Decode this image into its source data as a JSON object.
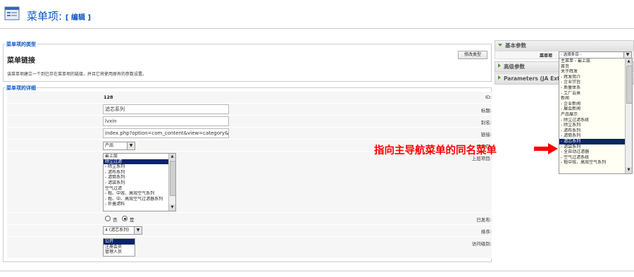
{
  "header": {
    "title": "菜单项:",
    "subtitle": "[ 编辑 ]"
  },
  "type_section": {
    "legend": "菜单项的类型",
    "heading": "菜单链接",
    "change_button": "修改类型",
    "description": "该菜单项建立一个到已存在菜单项的链接，并且它将使用原有的参数设置。"
  },
  "details": {
    "legend": "菜单项的详细",
    "id_label": "ID:",
    "id_value": "128",
    "title_label": "标题:",
    "title_value": "滤芯系列",
    "alias_label": "别名:",
    "alias_value": "lvxin",
    "link_label": "链接:",
    "link_value": "index.php?option=com_content&view=category&la",
    "menu_label": "显示在:",
    "menu_value": "产品",
    "parent_label": "上层项目:",
    "parent_items": [
      "最上层",
      "除尘过滤",
      "- 除尘系列",
      "- 滤布系列",
      "- 滤筒系列",
      "- 滤袋系列",
      "空气过滤",
      "- 粗、中效、高效空气系列",
      "- 粗、中、高效空气过滤器系列",
      "- 折叠滤料"
    ],
    "parent_selected_index": 1,
    "published_label": "已发布:",
    "published_no": "否",
    "published_yes": "是",
    "order_label": "排序:",
    "order_value": "4 (滤芯系列)",
    "access_label": "访问级别:",
    "access_items": [
      "公开",
      "注册会员",
      "管理人员"
    ],
    "access_selected_index": 0
  },
  "params": {
    "basic": "基本参数",
    "advanced": "高级参数",
    "ja": "Parameters (JA Exte",
    "menu_item_label": "菜单项",
    "menu_item_value": "- 选择条目 -",
    "dropdown_items": [
      "主菜单 - 最上层",
      "首页",
      "关于辉发",
      "- 辉发简介",
      "- 企业宗旨",
      "- 质量体系",
      "- 工厂云景",
      "新闻",
      "- 企业新闻",
      "- 展会新闻",
      "产品展示",
      "- 除尘过滤系统",
      "- 除尘系列",
      "- 滤布系列",
      "- 滤筒系列",
      "- 滤芯系列",
      "- 滤袋系列",
      "- 全自动过滤器",
      "- 空气过滤系统",
      "- 粗中效、高效空气系列"
    ],
    "dropdown_selected_index": 15
  },
  "annotation": {
    "text": "指向主导航菜单的同名菜单"
  },
  "colors": {
    "link_blue": "#0b55c4",
    "selection_navy": "#0a246a",
    "annotation_red": "#ff0000",
    "panel_green": "#5a9a2a"
  }
}
